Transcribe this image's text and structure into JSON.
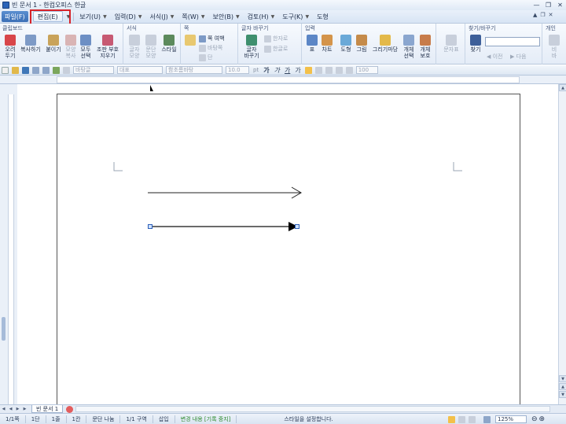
{
  "window": {
    "title": "빈 문서 1 - 한컴오피스 한글",
    "help": "?"
  },
  "menu": {
    "items": [
      {
        "label": "파일(F)",
        "key": "file"
      },
      {
        "label": "편집(E)",
        "key": "edit"
      },
      {
        "label": "보기(U)",
        "key": "view"
      },
      {
        "label": "입력(D)",
        "key": "input"
      },
      {
        "label": "서식(J)",
        "key": "format"
      },
      {
        "label": "쪽(W)",
        "key": "page"
      },
      {
        "label": "보안(B)",
        "key": "security"
      },
      {
        "label": "검토(H)",
        "key": "review"
      },
      {
        "label": "도구(K)",
        "key": "tools"
      },
      {
        "label": "도형",
        "key": "shape"
      }
    ]
  },
  "ribbon": {
    "clipboard": {
      "title": "클립보드",
      "cut": "오려\n두기",
      "copy": "복사하기",
      "paste": "붙이기",
      "format_copy": "모양\n복사",
      "select_all": "모두\n선택",
      "delete_symbol": "조판 부호\n지우기"
    },
    "format": {
      "title": "서식",
      "char_shape": "글자\n모양",
      "para_shape": "문단\n모양",
      "style": "스타일"
    },
    "page": {
      "title": "쪽",
      "page_setup": "쪽 여백",
      "background": "바탕쪽",
      "column": "단"
    },
    "change": {
      "title": "글자 바꾸기",
      "change_char": "글자\n바꾸기",
      "hanja": "한자로",
      "hangul": "한글로"
    },
    "insert": {
      "title": "입력",
      "table": "표",
      "chart": "차트",
      "shape": "도형",
      "picture": "그림",
      "drawing_market": "그리기마당",
      "object_select": "개체\n선택",
      "object_protect": "개체\n보호"
    },
    "symbol": {
      "title": "",
      "char_table": "문자표"
    },
    "find": {
      "title": "찾기/바꾸기",
      "find": "찾기",
      "prev": "이전",
      "next": "다음"
    },
    "personal": {
      "title": "개인",
      "label": "비\n바"
    }
  },
  "toolbar": {
    "style_combo": "바탕글",
    "lang_combo": "대표",
    "font_combo": "함초롬바탕",
    "size_combo": "10.0",
    "unit": "pt",
    "zoom_combo": "100"
  },
  "tabs": {
    "doc": "빈 문서 1"
  },
  "status": {
    "page": "1/1쪽",
    "section": "1단",
    "line": "1줄",
    "col": "1칸",
    "para": "문단 나눔",
    "area": "1/1 구역",
    "insert": "삽입",
    "track": "변경 내용 [기록 중지]",
    "message": "스타일을 설정합니다.",
    "zoom": "125%"
  }
}
